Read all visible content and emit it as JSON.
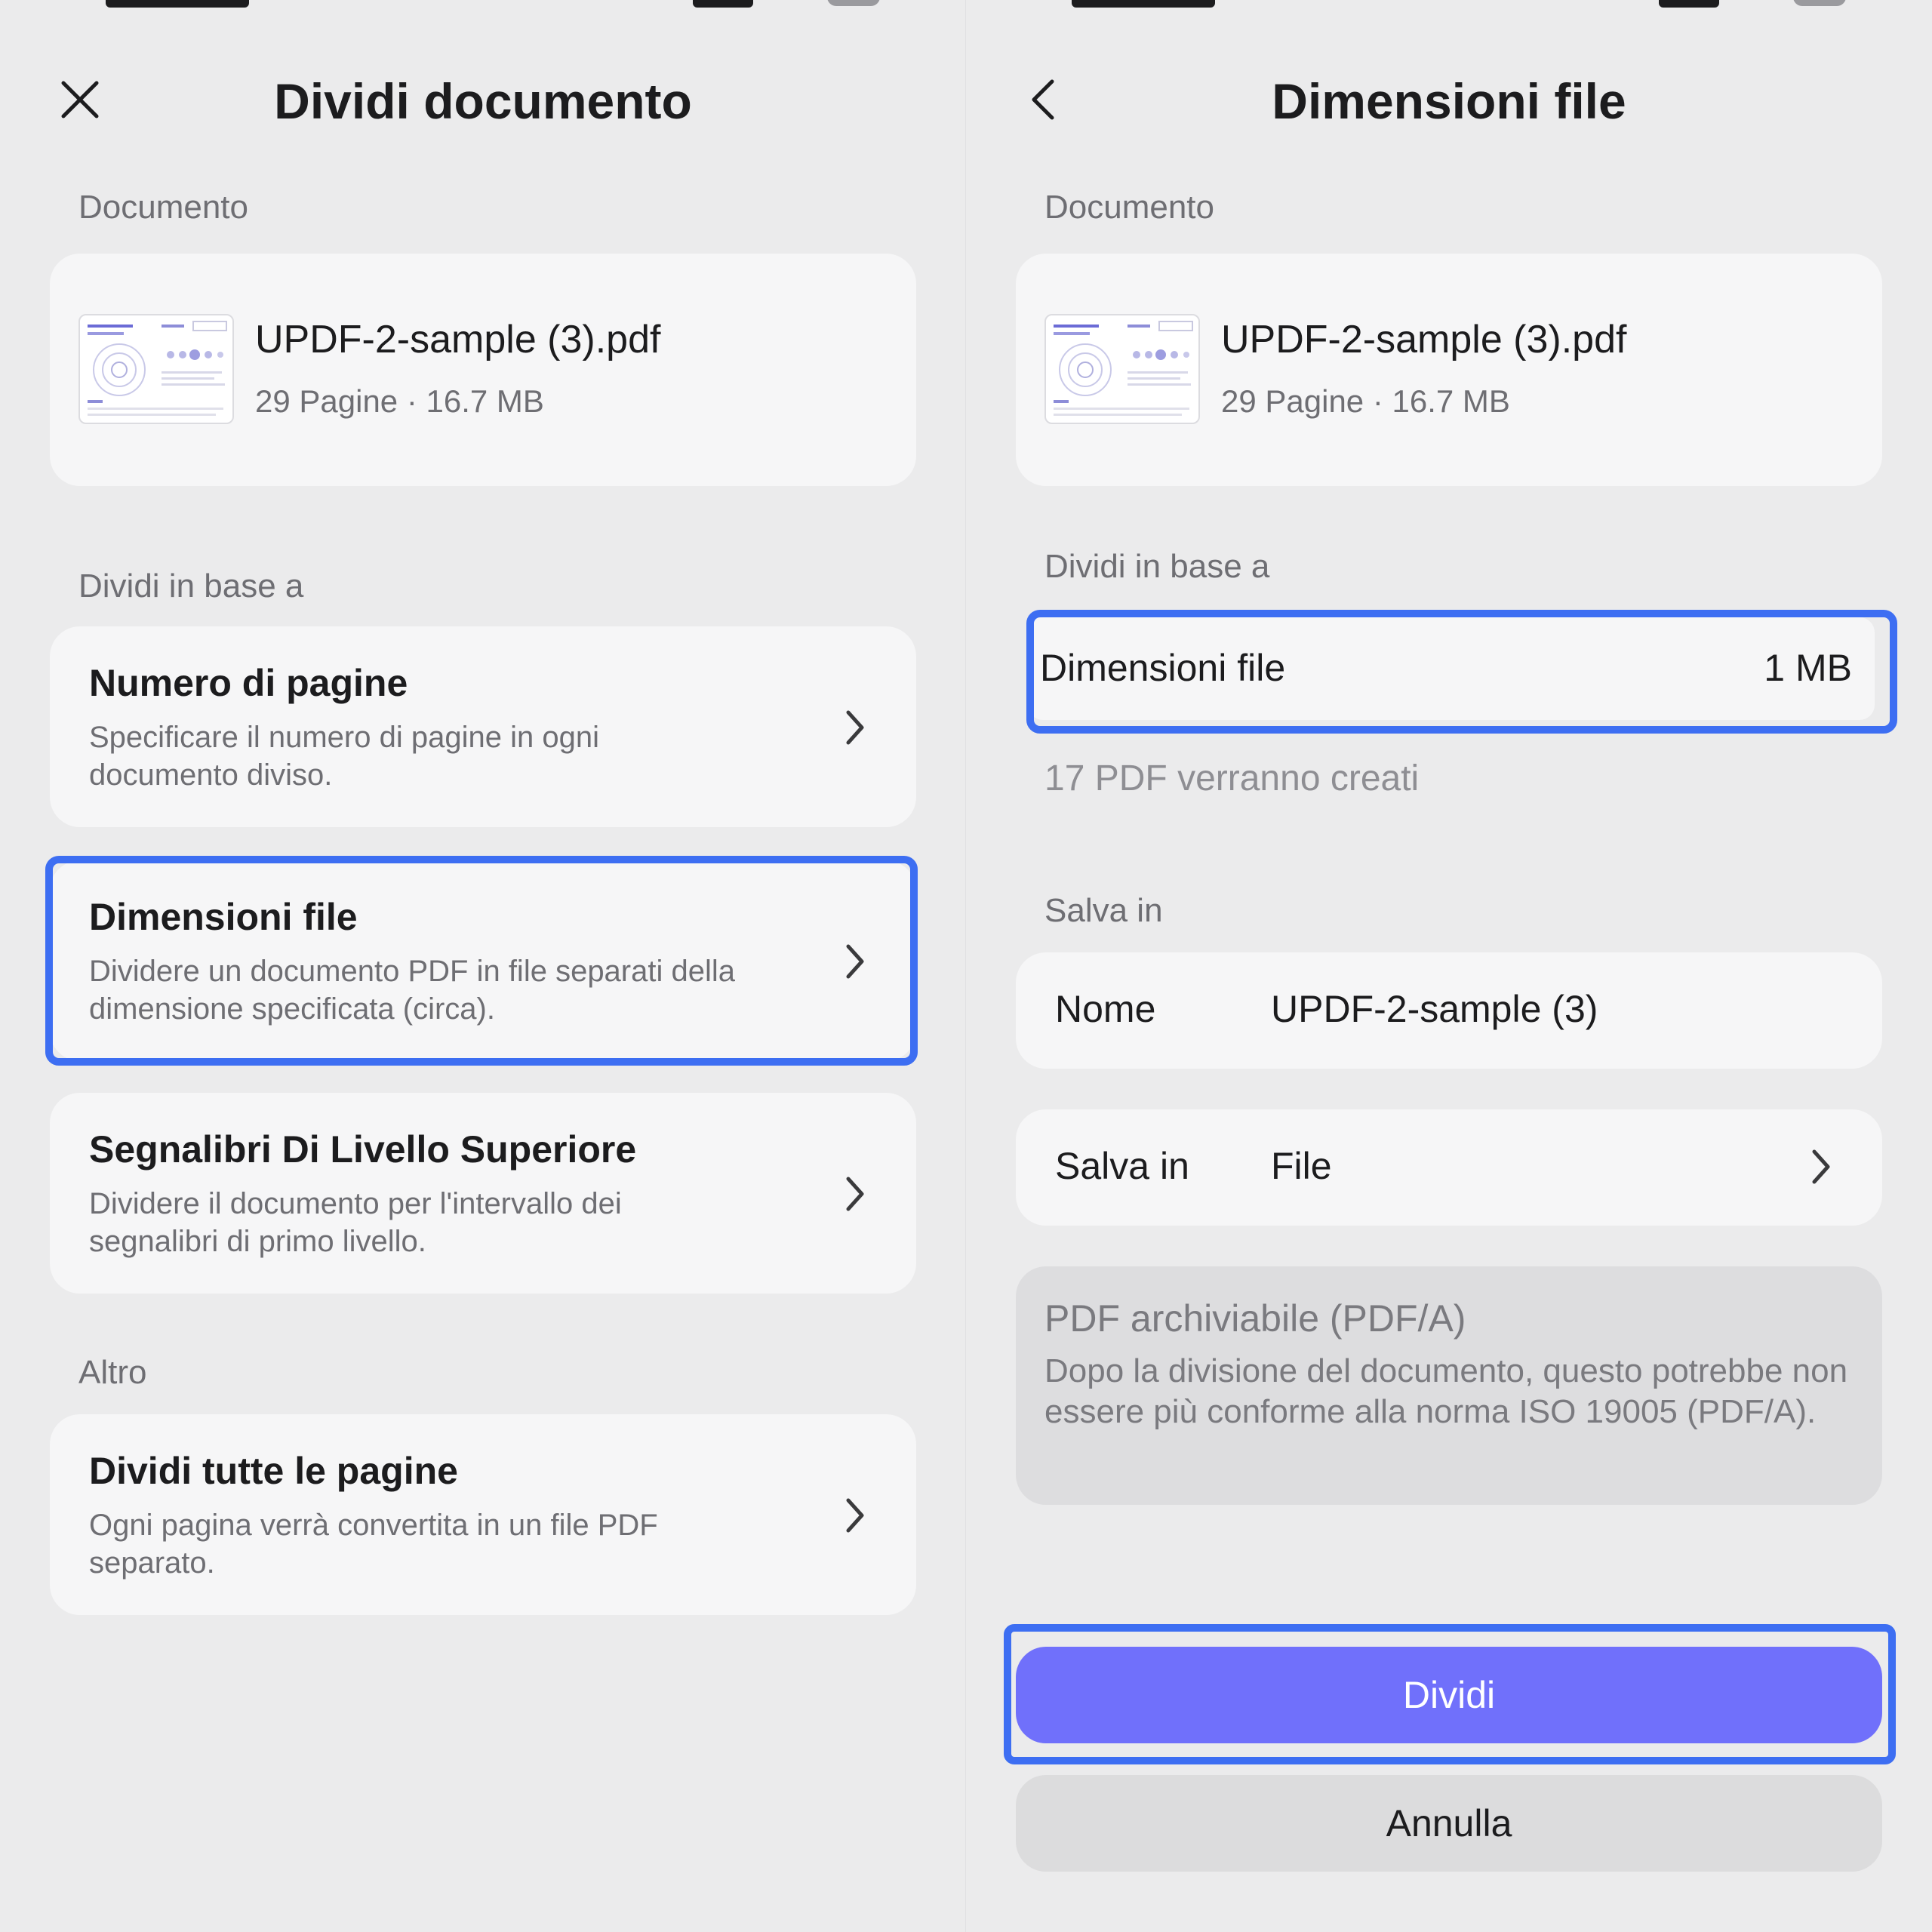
{
  "left": {
    "title": "Dividi documento",
    "document_label": "Documento",
    "file_name": "UPDF-2-sample (3).pdf",
    "file_meta": "29 Pagine · 16.7 MB",
    "split_by_label": "Dividi in base a",
    "options": [
      {
        "title": "Numero di pagine",
        "desc": "Specificare il numero di pagine in ogni documento diviso."
      },
      {
        "title": "Dimensioni file",
        "desc": "Dividere un documento PDF in file separati della dimensione specificata (circa)."
      },
      {
        "title": "Segnalibri Di Livello Superiore",
        "desc": "Dividere il documento per l'intervallo dei segnalibri di primo livello."
      }
    ],
    "other_label": "Altro",
    "other_option": {
      "title": "Dividi tutte le pagine",
      "desc": "Ogni pagina verrà convertita in un file PDF separato."
    }
  },
  "right": {
    "title": "Dimensioni file",
    "document_label": "Documento",
    "file_name": "UPDF-2-sample (3).pdf",
    "file_meta": "29 Pagine · 16.7 MB",
    "split_by_label": "Dividi in base a",
    "size_label": "Dimensioni file",
    "size_value": "1 MB",
    "result_note": "17 PDF verranno creati",
    "save_in_label": "Salva in",
    "name_label": "Nome",
    "name_value": "UPDF-2-sample (3)",
    "save_location_label": "Salva in",
    "save_location_value": "File",
    "pdfa_title": "PDF archiviabile (PDF/A)",
    "pdfa_desc": "Dopo la divisione del documento, questo potrebbe non essere più conforme alla norma ISO 19005 (PDF/A).",
    "split_button": "Dividi",
    "cancel_button": "Annulla"
  },
  "colors": {
    "accent": "#7070fb",
    "highlight": "#3d6ef2",
    "background": "#ebebec",
    "card": "#f6f6f7"
  },
  "icons": {
    "close": "close-icon",
    "back": "chevron-left-icon",
    "chevron": "chevron-right-icon"
  }
}
